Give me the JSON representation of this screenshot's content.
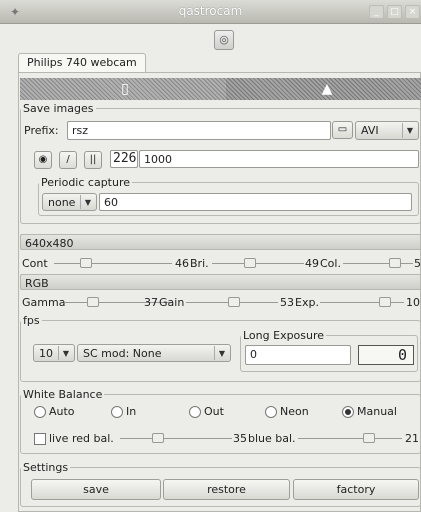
{
  "window": {
    "title": "qastrocam",
    "tab_label": "Philips 740 webcam",
    "power_glyph": "◎"
  },
  "save_images": {
    "legend": "Save images",
    "prefix_label": "Prefix:",
    "prefix_value": "rsz",
    "format": "AVI",
    "counter": "226",
    "frames": "1000",
    "periodic": {
      "legend": "Periodic capture",
      "mode": "none",
      "value": "60"
    }
  },
  "resolution": "640x480",
  "row1": {
    "cont_label": "Cont",
    "cont_value": "46",
    "bri_label": "Bri.",
    "bri_value": "49",
    "col_label": "Col.",
    "col_value": "5"
  },
  "palette": "RGB",
  "row2": {
    "gamma_label": "Gamma",
    "gamma_value": "37",
    "gain_label": "Gain",
    "gain_value": "53",
    "exp_label": "Exp.",
    "exp_value": "10"
  },
  "fps": {
    "legend": "fps",
    "value": "10",
    "sc_mode": "SC mod: None",
    "long_legend": "Long Exposure",
    "long_value": "0",
    "lcd_value": "0"
  },
  "white_balance": {
    "legend": "White Balance",
    "options": [
      "Auto",
      "In",
      "Out",
      "Neon",
      "Manual"
    ],
    "selected": "Manual",
    "live_label": "live",
    "red_label": "red bal.",
    "red_value": "35",
    "blue_label": "blue bal.",
    "blue_value": "21"
  },
  "settings": {
    "legend": "Settings",
    "save_label": "save",
    "restore_label": "restore",
    "factory_label": "factory"
  },
  "levels": {
    "cont": 0.22,
    "bri": 0.4,
    "col": 0.8,
    "gamma": 0.24,
    "gain": 0.52,
    "exp": 0.82,
    "red": 0.3,
    "blue": 0.7
  }
}
